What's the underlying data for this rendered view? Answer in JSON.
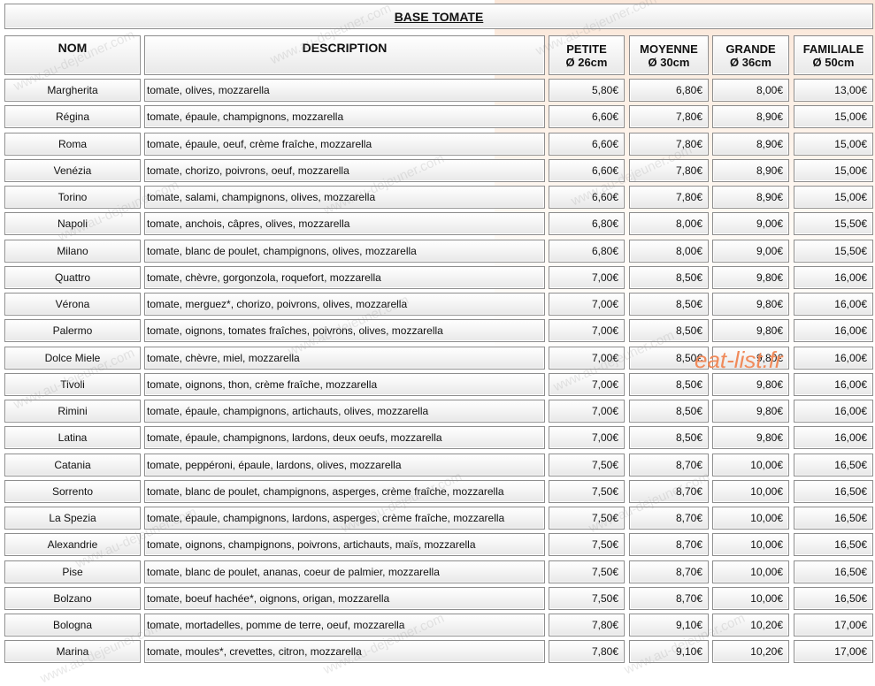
{
  "title": "BASE TOMATE",
  "headers": {
    "nom": "NOM",
    "description": "DESCRIPTION",
    "sizes": [
      {
        "label": "PETITE",
        "diameter": "Ø 26cm"
      },
      {
        "label": "MOYENNE",
        "diameter": "Ø 30cm"
      },
      {
        "label": "GRANDE",
        "diameter": "Ø 36cm"
      },
      {
        "label": "FAMILIALE",
        "diameter": "Ø 50cm"
      }
    ]
  },
  "pizzas": [
    {
      "name": "Margherita",
      "description": "tomate, olives, mozzarella",
      "prices": [
        "5,80€",
        "6,80€",
        "8,00€",
        "13,00€"
      ]
    },
    {
      "name": "Régina",
      "description": "tomate, épaule, champignons, mozzarella",
      "prices": [
        "6,60€",
        "7,80€",
        "8,90€",
        "15,00€"
      ]
    },
    {
      "name": "Roma",
      "description": "tomate, épaule, oeuf, crème fraîche, mozzarella",
      "prices": [
        "6,60€",
        "7,80€",
        "8,90€",
        "15,00€"
      ]
    },
    {
      "name": "Venézia",
      "description": "tomate, chorizo, poivrons, oeuf, mozzarella",
      "prices": [
        "6,60€",
        "7,80€",
        "8,90€",
        "15,00€"
      ]
    },
    {
      "name": "Torino",
      "description": "tomate, salami, champignons, olives, mozzarella",
      "prices": [
        "6,60€",
        "7,80€",
        "8,90€",
        "15,00€"
      ]
    },
    {
      "name": "Napoli",
      "description": "tomate, anchois, câpres, olives, mozzarella",
      "prices": [
        "6,80€",
        "8,00€",
        "9,00€",
        "15,50€"
      ]
    },
    {
      "name": "Milano",
      "description": "tomate, blanc de poulet, champignons, olives, mozzarella",
      "prices": [
        "6,80€",
        "8,00€",
        "9,00€",
        "15,50€"
      ]
    },
    {
      "name": "Quattro",
      "description": "tomate, chèvre, gorgonzola, roquefort, mozzarella",
      "prices": [
        "7,00€",
        "8,50€",
        "9,80€",
        "16,00€"
      ]
    },
    {
      "name": "Vérona",
      "description": "tomate, merguez*, chorizo, poivrons, olives, mozzarella",
      "prices": [
        "7,00€",
        "8,50€",
        "9,80€",
        "16,00€"
      ]
    },
    {
      "name": "Palermo",
      "description": "tomate, oignons, tomates fraîches, poivrons, olives, mozzarella",
      "prices": [
        "7,00€",
        "8,50€",
        "9,80€",
        "16,00€"
      ]
    },
    {
      "name": "Dolce Miele",
      "description": "tomate, chèvre, miel, mozzarella",
      "prices": [
        "7,00€",
        "8,50€",
        "9,80€",
        "16,00€"
      ]
    },
    {
      "name": "Tivoli",
      "description": "tomate, oignons, thon, crème fraîche, mozzarella",
      "prices": [
        "7,00€",
        "8,50€",
        "9,80€",
        "16,00€"
      ]
    },
    {
      "name": "Rimini",
      "description": "tomate, épaule, champignons, artichauts, olives, mozzarella",
      "prices": [
        "7,00€",
        "8,50€",
        "9,80€",
        "16,00€"
      ]
    },
    {
      "name": "Latina",
      "description": "tomate, épaule, champignons, lardons, deux oeufs, mozzarella",
      "prices": [
        "7,00€",
        "8,50€",
        "9,80€",
        "16,00€"
      ]
    },
    {
      "name": "Catania",
      "description": "tomate, pepp&eacute;roni, épaule, lardons, olives, mozzarella",
      "prices": [
        "7,50€",
        "8,70€",
        "10,00€",
        "16,50€"
      ]
    },
    {
      "name": "Sorrento",
      "description": "tomate, blanc de poulet, champignons, asperges, crème fraîche, mozzarella",
      "prices": [
        "7,50€",
        "8,70€",
        "10,00€",
        "16,50€"
      ]
    },
    {
      "name": "La Spezia",
      "description": "tomate, épaule, champignons, lardons, asperges, crème fraîche, mozzarella",
      "prices": [
        "7,50€",
        "8,70€",
        "10,00€",
        "16,50€"
      ]
    },
    {
      "name": "Alexandrie",
      "description": "tomate, oignons, champignons, poivrons, artichauts, maïs, mozzarella",
      "prices": [
        "7,50€",
        "8,70€",
        "10,00€",
        "16,50€"
      ]
    },
    {
      "name": "Pise",
      "description": "tomate, blanc de poulet, ananas, coeur de palmier, mozzarella",
      "prices": [
        "7,50€",
        "8,70€",
        "10,00€",
        "16,50€"
      ]
    },
    {
      "name": "Bolzano",
      "description": "tomate, boeuf hachée*, oignons, origan, mozzarella",
      "prices": [
        "7,50€",
        "8,70€",
        "10,00€",
        "16,50€"
      ]
    },
    {
      "name": "Bologna",
      "description": "tomate, mortadelles, pomme de terre, oeuf, mozzarella",
      "prices": [
        "7,80€",
        "9,10€",
        "10,20€",
        "17,00€"
      ]
    },
    {
      "name": "Marina",
      "description": "tomate, moules*, crevettes, citron, mozzarella",
      "prices": [
        "7,80€",
        "9,10€",
        "10,20€",
        "17,00€"
      ]
    }
  ],
  "watermark_text": "www.au-dejeuner.com",
  "brand_text": "eat-list.fr"
}
